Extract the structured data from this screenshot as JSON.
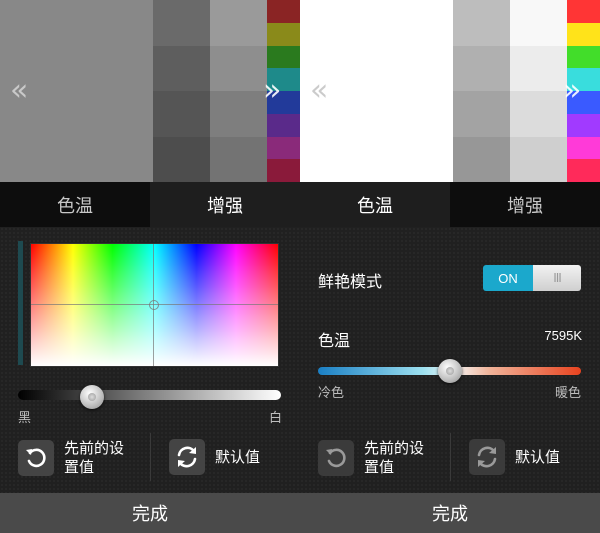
{
  "left_panel": {
    "preview": {
      "big_color": "#888888",
      "col1": [
        "#6a6a6a",
        "#5e5e5e",
        "#555555",
        "#4d4d4d"
      ],
      "col2": [
        "#9a9a9a",
        "#8e8e8e",
        "#7e7e7e",
        "#737373"
      ],
      "strip": [
        "#8a2424",
        "#8a8a1a",
        "#2a7a1e",
        "#1e8a8a",
        "#223a9a",
        "#5a2a8a",
        "#8a2a7a",
        "#8a1a3a"
      ],
      "prev_chevron": "«",
      "next_chevron": "»"
    },
    "tabs": [
      {
        "label": "色温",
        "selected": false
      },
      {
        "label": "增强",
        "selected": true
      }
    ],
    "picker": {
      "crosshair_x": 0.5,
      "crosshair_y": 0.5
    },
    "gray_slider": {
      "value": 0.28,
      "min_label": "黑",
      "max_label": "白"
    },
    "buttons": {
      "previous_label": "先前的设\n置值",
      "default_label": "默认值",
      "previous_icon": "undo-icon",
      "default_icon": "refresh-icon"
    },
    "done_label": "完成"
  },
  "right_panel": {
    "preview": {
      "big_color": "#ffffff",
      "col1": [
        "#bdbdbd",
        "#b0b0b0",
        "#a3a3a3",
        "#979797"
      ],
      "col2": [
        "#f8f8f8",
        "#ececec",
        "#dcdcdc",
        "#cfcfcf"
      ],
      "strip": [
        "#ff3535",
        "#ffe31a",
        "#42dd2a",
        "#39dddd",
        "#3a5aff",
        "#a13aff",
        "#ff3ad8",
        "#ff2a5a"
      ],
      "prev_chevron": "«",
      "next_chevron": "»"
    },
    "tabs": [
      {
        "label": "色温",
        "selected": true
      },
      {
        "label": "增强",
        "selected": false
      }
    ],
    "vivid_mode": {
      "label": "鲜艳模式",
      "toggle_on_label": "ON",
      "toggle_thumb": "III",
      "state": true
    },
    "color_temp": {
      "label": "色温",
      "value_text": "7595K",
      "position": 0.5,
      "cold_label": "冷色",
      "warm_label": "暖色"
    },
    "buttons": {
      "previous_label": "先前的设\n置值",
      "default_label": "默认值",
      "previous_icon": "undo-icon",
      "default_icon": "refresh-icon",
      "disabled": true
    },
    "done_label": "完成"
  }
}
